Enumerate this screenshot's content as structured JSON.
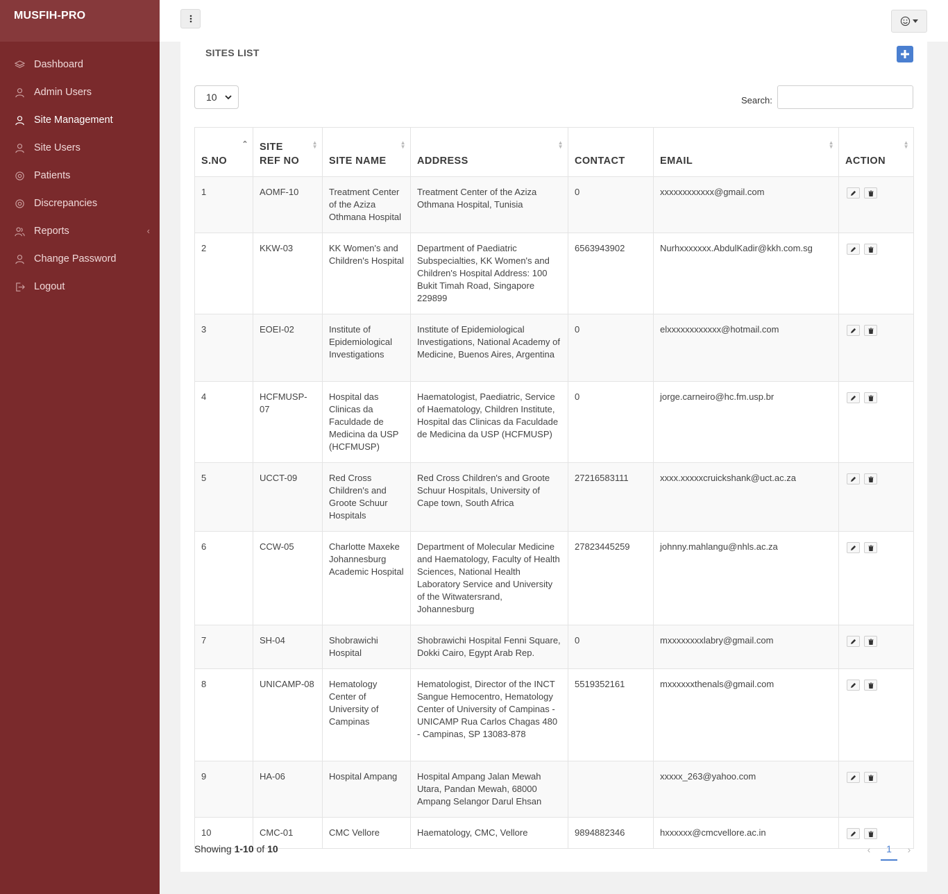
{
  "app": {
    "brand": "MUSFIH-PRO"
  },
  "sidebar": {
    "items": [
      {
        "label": "Dashboard",
        "icon": "layers-icon"
      },
      {
        "label": "Admin Users",
        "icon": "user-icon"
      },
      {
        "label": "Site Management",
        "icon": "user-icon",
        "active": true
      },
      {
        "label": "Site Users",
        "icon": "user-icon"
      },
      {
        "label": "Patients",
        "icon": "gear-icon"
      },
      {
        "label": "Discrepancies",
        "icon": "gear-icon"
      },
      {
        "label": "Reports",
        "icon": "user-group-icon",
        "has_submenu": true
      },
      {
        "label": "Change Password",
        "icon": "user-icon"
      },
      {
        "label": "Logout",
        "icon": "logout-icon"
      }
    ]
  },
  "card": {
    "title": "SITES LIST"
  },
  "controls": {
    "page_length": "10",
    "search_label": "Search:",
    "search_value": ""
  },
  "table": {
    "headers": {
      "sno": "S.NO",
      "ref1": "SITE",
      "ref2": "REF NO",
      "name": "SITE NAME",
      "address": "ADDRESS",
      "contact": "CONTACT",
      "email": "EMAIL",
      "action": "ACTION"
    },
    "rows": [
      {
        "sno": "1",
        "ref": "AOMF-10",
        "name": "Treatment Center of the Aziza Othmana Hospital",
        "address": "Treatment Center of the Aziza Othmana Hospital, Tunisia",
        "contact": "0",
        "email": "xxxxxxxxxxxx@gmail.com"
      },
      {
        "sno": "2",
        "ref": "KKW-03",
        "name": "KK Women's and Children's Hospital",
        "address": "Department of Paediatric Subspecialties, KK Women's and Children's Hospital Address: 100 Bukit Timah Road, Singapore 229899",
        "contact": "6563943902",
        "email": "Nurhxxxxxxx.AbdulKadir@kkh.com.sg"
      },
      {
        "sno": "3",
        "ref": "EOEI-02",
        "name": "Institute of Epidemiological Investigations",
        "address": "Institute of Epidemiological Investigations, National Academy of Medicine, Buenos Aires, Argentina",
        "contact": "0",
        "email": "elxxxxxxxxxxxx@hotmail.com"
      },
      {
        "sno": "4",
        "ref": "HCFMUSP-07",
        "name": "Hospital das Clinicas da Faculdade de Medicina da USP (HCFMUSP)",
        "address": "Haematologist, Paediatric, Service of Haematology, Children Institute, Hospital das Clinicas da Faculdade de Medicina da USP (HCFMUSP)",
        "contact": "0",
        "email": "jorge.carneiro@hc.fm.usp.br"
      },
      {
        "sno": "5",
        "ref": "UCCT-09",
        "name": "Red Cross Children's and Groote Schuur Hospitals",
        "address": "Red Cross Children's and Groote Schuur Hospitals, University of Cape town, South Africa",
        "contact": "27216583111",
        "email": "xxxx.xxxxxcruickshank@uct.ac.za"
      },
      {
        "sno": "6",
        "ref": "CCW-05",
        "name": "Charlotte Maxeke Johannesburg Academic Hospital",
        "address": "Department of Molecular Medicine and Haematology, Faculty of Health Sciences, National Health Laboratory Service and University of the Witwatersrand, Johannesburg",
        "contact": "27823445259",
        "email": "johnny.mahlangu@nhls.ac.za"
      },
      {
        "sno": "7",
        "ref": "SH-04",
        "name": "Shobrawichi Hospital",
        "address": "Shobrawichi Hospital Fenni Square, Dokki Cairo, Egypt Arab Rep.",
        "contact": "0",
        "email": "mxxxxxxxxlabry@gmail.com"
      },
      {
        "sno": "8",
        "ref": "UNICAMP-08",
        "name": "Hematology Center of University of Campinas",
        "address": "Hematologist, Director of the INCT Sangue Hemocentro, Hematology Center of University of Campinas - UNICAMP Rua Carlos Chagas 480 - Campinas, SP 13083-878",
        "contact": "5519352161",
        "email": "mxxxxxxthenals@gmail.com"
      },
      {
        "sno": "9",
        "ref": "HA-06",
        "name": "Hospital Ampang",
        "address": "Hospital Ampang Jalan Mewah Utara, Pandan Mewah, 68000 Ampang Selangor Darul Ehsan",
        "contact": "",
        "email": "xxxxx_263@yahoo.com"
      },
      {
        "sno": "10",
        "ref": "CMC-01",
        "name": "CMC Vellore",
        "address": "Haematology, CMC, Vellore",
        "contact": "9894882346",
        "email": "hxxxxxx@cmcvellore.ac.in"
      }
    ]
  },
  "footer": {
    "showing_prefix": "Showing ",
    "showing_range": "1-10",
    "showing_of": " of ",
    "showing_total": "10",
    "current_page": "1"
  }
}
